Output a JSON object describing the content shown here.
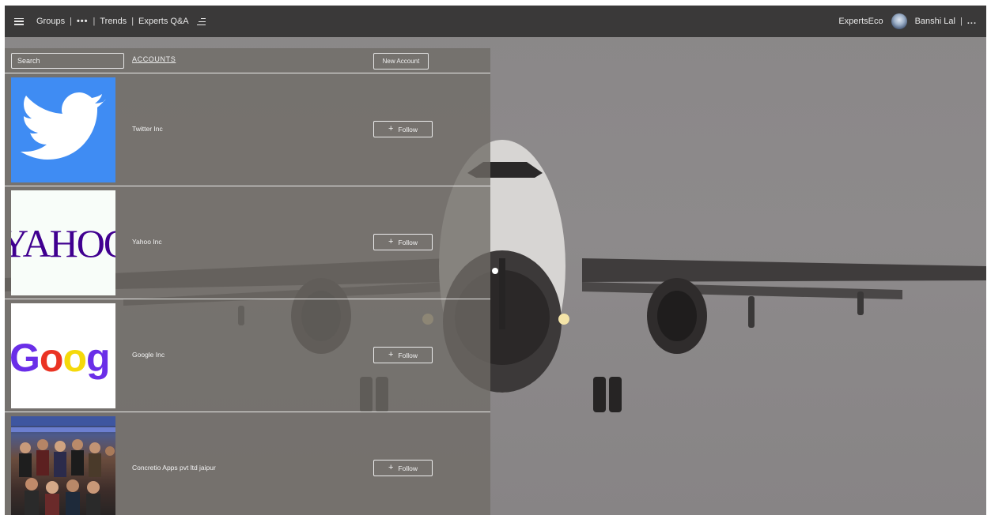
{
  "nav": {
    "groups": "Groups",
    "sep1": "|",
    "more": "•••",
    "sep2": "|",
    "trends": "Trends",
    "sep3": "|",
    "experts_qa": "Experts Q&A",
    "brand": "ExpertsEco",
    "user": "Banshi Lal",
    "sep4": "|",
    "user_more": "..."
  },
  "panel": {
    "search_placeholder": "Search",
    "title": "ACCOUNTS",
    "new_account": "New Account"
  },
  "accounts": [
    {
      "name": "Twitter Inc",
      "follow": "Follow",
      "plus": "+",
      "logo": "twitter-logo"
    },
    {
      "name": "Yahoo Inc",
      "follow": "Follow",
      "plus": "+",
      "logo": "yahoo-logo",
      "logo_text": "YAHOO"
    },
    {
      "name": "Google Inc",
      "follow": "Follow",
      "plus": "+",
      "logo": "google-logo",
      "logo_text": "Goog"
    },
    {
      "name": "Concretio Apps pvt ltd jaipur",
      "follow": "Follow",
      "plus": "+",
      "logo": "group-photo"
    }
  ],
  "colors": {
    "navbar": "#3a3939",
    "twitter_blue": "#3f8cf3",
    "yahoo_purple": "#400090",
    "google_purple": "#6a2ee8",
    "google_red": "#ea3323",
    "google_yellow": "#f5d90a"
  }
}
